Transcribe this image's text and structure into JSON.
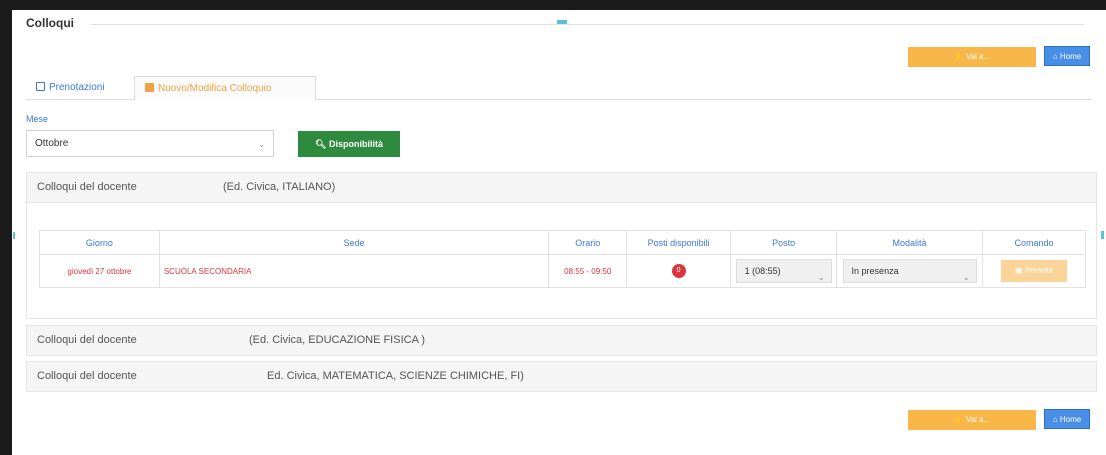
{
  "page": {
    "title": "Colloqui"
  },
  "actions": {
    "vai_label": "Vai a...",
    "home_label": "Home"
  },
  "tabs": [
    {
      "label": "Prenotazioni",
      "icon": "calendar-icon"
    },
    {
      "label": "Nuovo/Modifica Colloquio",
      "icon": "calendar-edit-icon"
    }
  ],
  "filter": {
    "mese_label": "Mese",
    "mese_value": "Ottobre",
    "disponibilita_label": "Disponibilità"
  },
  "panels": [
    {
      "label": "Colloqui del docente",
      "detail": "(Ed. Civica, ITALIANO)"
    },
    {
      "label": "Colloqui del docente",
      "detail": "(Ed. Civica, EDUCAZIONE FISICA )"
    },
    {
      "label": "Colloqui del docente",
      "detail": "Ed. Civica, MATEMATICA, SCIENZE CHIMICHE, FI)"
    }
  ],
  "table": {
    "headers": [
      "Giorno",
      "Sede",
      "Orario",
      "Posti disponibili",
      "Posto",
      "Modalità",
      "Comando"
    ],
    "row": {
      "giorno": "giovedì 27 ottobre",
      "sede": "SCUOLA SECONDARIA",
      "orario": "08:55 - 09:50",
      "posti": "0",
      "posto": "1 (08:55)",
      "modalita": "In presenza",
      "comando": "Prenota"
    }
  },
  "colors": {
    "accent": "#3a7ad6",
    "warning": "#f9b649",
    "success": "#2e8a3d",
    "danger": "#d9363e"
  }
}
